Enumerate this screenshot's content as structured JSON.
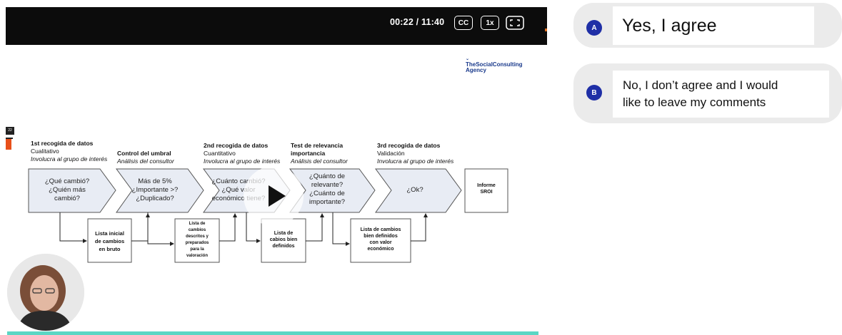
{
  "player": {
    "time": "00:22 / 11:40",
    "cc_label": "CC",
    "speed_label": "1x",
    "side_tag": "22"
  },
  "slide": {
    "logo": {
      "line1": "TheSocialConsulting",
      "line2": "Agency"
    },
    "stages": [
      {
        "title": "1st recogida de datos",
        "sub": "Cualitativo",
        "note": "Involucra al grupo de interés",
        "box": [
          "¿Qué cambió?",
          "¿Quién más",
          "cambió?"
        ]
      },
      {
        "title": "Control del umbral",
        "sub": "",
        "note": "Análisis del consultor",
        "box": [
          "Más de 5%",
          "¿Importante >?",
          "¿Duplicado?"
        ]
      },
      {
        "title": "2nd recogida de datos",
        "sub": "Cuantitativo",
        "note": "Involucra al grupo de interés",
        "box": [
          "¿Cuánto cambió?",
          "¿Qué valor",
          "económico tiene?"
        ]
      },
      {
        "title": "Test de relevancia",
        "title2": "importancia",
        "sub": "",
        "note": "Análisis del consultor",
        "box": [
          "¿Quánto de",
          "relevante?",
          "¿Cuánto de",
          "importante?"
        ]
      },
      {
        "title": "3rd recogida de datos",
        "sub": "Validación",
        "note": "Involucra al grupo de interés",
        "box": [
          "¿Ok?"
        ]
      }
    ],
    "final_box": [
      "Informe",
      "SROI"
    ],
    "outputs": [
      [
        "Lista inicial",
        "de cambios",
        "en bruto"
      ],
      [
        "Lista de",
        "cambios",
        "descritos y",
        "preparados",
        "para la",
        "valoración"
      ],
      [
        "Lista de",
        "cabios bien",
        "definidos"
      ],
      [
        "Lista de cambios",
        "bien definidos",
        "con valor",
        "económico"
      ]
    ]
  },
  "options": [
    {
      "badge": "A",
      "label": "Yes, I agree"
    },
    {
      "badge": "B",
      "label_line1": "No, I don’t agree and I would",
      "label_line2": "like to leave my comments"
    }
  ],
  "progress": 0.031
}
